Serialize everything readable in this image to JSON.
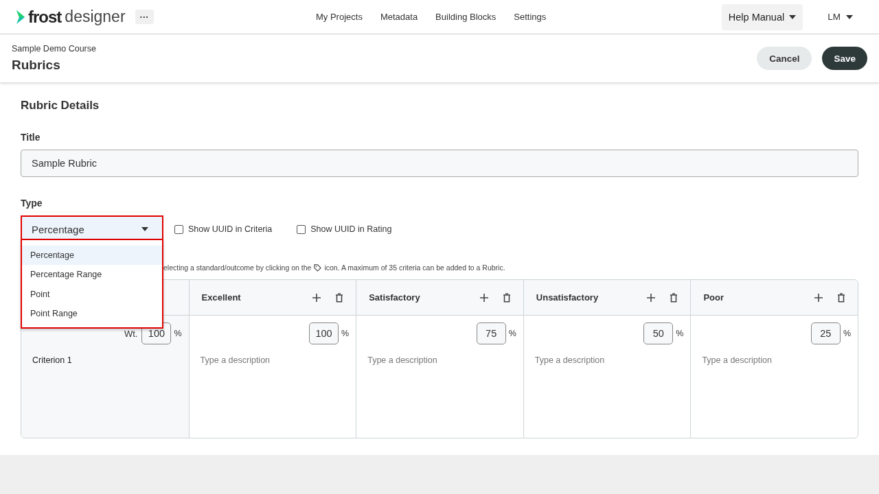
{
  "header": {
    "logo": {
      "bold": "frost",
      "light": "designer"
    },
    "more_button": "···",
    "nav": [
      "My Projects",
      "Metadata",
      "Building Blocks",
      "Settings"
    ],
    "help_menu": "Help Manual",
    "user_menu": "LM"
  },
  "page": {
    "breadcrumb": "Sample Demo Course",
    "title": "Rubrics",
    "cancel": "Cancel",
    "save": "Save"
  },
  "details": {
    "heading": "Rubric Details",
    "title_label": "Title",
    "title_value": "Sample Rubric",
    "type_label": "Type",
    "type_select": {
      "value": "Percentage",
      "open": true,
      "options": [
        {
          "label": "Percentage",
          "selected": true
        },
        {
          "label": "Percentage Range",
          "selected": false
        },
        {
          "label": "Point",
          "selected": false
        },
        {
          "label": "Point Range",
          "selected": false
        }
      ]
    },
    "checkboxes": [
      {
        "label": "Show UUID in Criteria",
        "checked": false
      },
      {
        "label": "Show UUID in Rating",
        "checked": false
      }
    ],
    "hint_before": "electing a standard/outcome by clicking on the",
    "hint_after": "icon. A maximum of 35 criteria can be added to a Rubric."
  },
  "rubric": {
    "levels": [
      {
        "name": "Excellent"
      },
      {
        "name": "Satisfactory"
      },
      {
        "name": "Unsatisfactory"
      },
      {
        "name": "Poor"
      }
    ],
    "criteria": [
      {
        "name": "Criterion 1",
        "weight_label": "Wt.",
        "weight": "100",
        "unit": "%",
        "cells": [
          {
            "score": "100",
            "unit": "%",
            "placeholder": "Type a description"
          },
          {
            "score": "75",
            "unit": "%",
            "placeholder": "Type a description"
          },
          {
            "score": "50",
            "unit": "%",
            "placeholder": "Type a description"
          },
          {
            "score": "25",
            "unit": "%",
            "placeholder": "Type a description"
          }
        ]
      }
    ]
  }
}
